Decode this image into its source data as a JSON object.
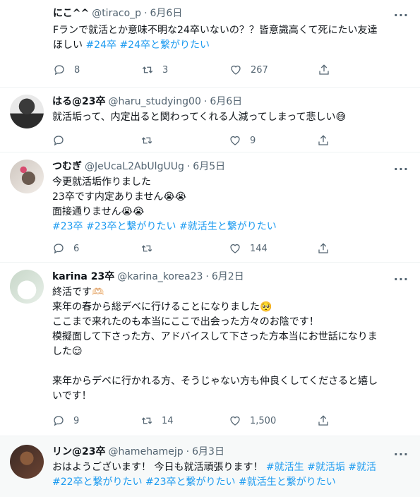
{
  "tweets": [
    {
      "name": "にこ^^",
      "handle": "@tiraco_p",
      "date": "6月6日",
      "lines": [
        "Fランで就活とか意味不明な24卒いないの？？皆意識高くて死にたい友達"
      ],
      "line2_text": "ほしい ",
      "hashtags": [
        "#24卒",
        "#24卒と繋がりたい"
      ],
      "replies": "8",
      "retweets": "3",
      "likes": "267"
    },
    {
      "name": "はる@23卒",
      "handle": "@haru_studying00",
      "date": "6月6日",
      "text": "就活垢って、内定出ると関わってくれる人減ってしまって悲しい😅",
      "replies": "",
      "retweets": "",
      "likes": "9"
    },
    {
      "name": "つむぎ",
      "handle": "@JeUcaL2AbUlgUUg",
      "date": "6月5日",
      "lines": [
        "今更就活垢作りました",
        "23卒です内定ありません😭😭",
        "面接通りません😭😭"
      ],
      "hashtags": [
        "#23卒",
        "#23卒と繋がりたい",
        "#就活生と繋がりたい"
      ],
      "replies": "6",
      "retweets": "",
      "likes": "144"
    },
    {
      "name": "karina 23卒",
      "handle": "@karina_korea23",
      "date": "6月2日",
      "lines": [
        "終活です🫶🏻",
        "来年の春から総デベに行けることになりました🥺",
        "ここまで来れたのも本当にここで出会った方々のお陰です！",
        "模擬面して下さった方、アドバイスして下さった方本当にお世話になりま",
        "した😌",
        "",
        "来年からデベに行かれる方、そうじゃない方も仲良くしてくださると嬉し",
        "いです！"
      ],
      "replies": "9",
      "retweets": "14",
      "likes": "1,500"
    },
    {
      "name": "リン@23卒",
      "handle": "@hamehamejp",
      "date": "6月3日",
      "text": "おはようございます！ 今日も就活頑張ります！ ",
      "hashtags_line1": [
        "#就活生",
        "#就活垢",
        "#就活"
      ],
      "hashtags_line2": [
        "#22卒と繋がりたい",
        "#23卒と繋がりたい",
        "#就活生と繋がりたい"
      ]
    }
  ],
  "icons": {
    "reply": "reply-icon",
    "retweet": "retweet-icon",
    "like": "heart-icon",
    "share": "share-icon",
    "more": "more-icon"
  },
  "ui": {
    "dot": "·",
    "more": "···"
  },
  "colors": {
    "accent": "#1d9bf0",
    "muted": "#536471",
    "text": "#0f1419"
  }
}
